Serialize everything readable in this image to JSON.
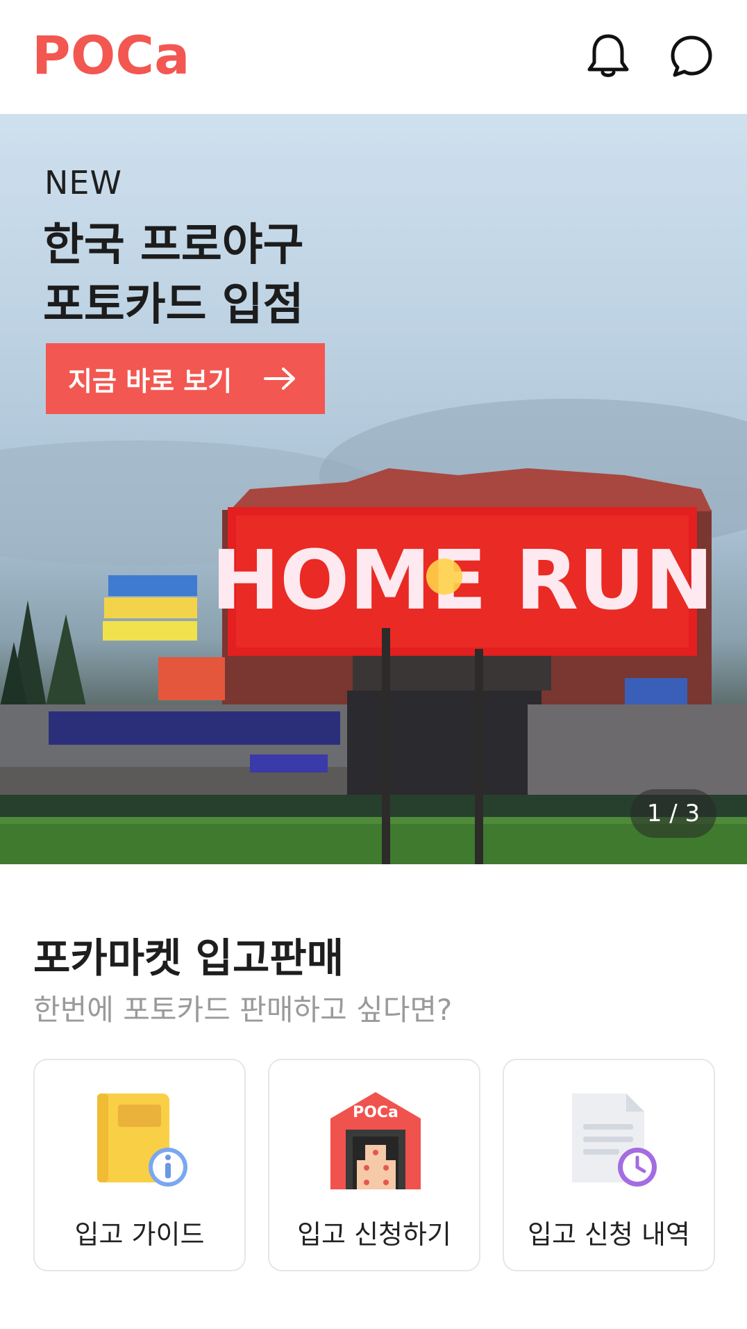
{
  "header": {
    "logo_text": "POCa",
    "notifications_icon": "bell-icon",
    "chat_icon": "chat-bubble-icon",
    "accent_color": "#f35751"
  },
  "banner": {
    "badge": "NEW",
    "title_line1": "한국 프로야구",
    "title_line2": "포토카드 입점",
    "cta_label": "지금 바로 보기",
    "cta_icon": "arrow-right-icon",
    "pager": "1 / 3",
    "scoreboard_text": "HOME RUN"
  },
  "section": {
    "title": "포카마켓 입고판매",
    "subtitle": "한번에 포토카드 판매하고 싶다면?",
    "cards": [
      {
        "label": "입고 가이드",
        "icon": "guide-book-icon"
      },
      {
        "label": "입고 신청하기",
        "icon": "warehouse-icon",
        "icon_text": "POCa"
      },
      {
        "label": "입고 신청 내역",
        "icon": "document-history-icon"
      }
    ]
  }
}
